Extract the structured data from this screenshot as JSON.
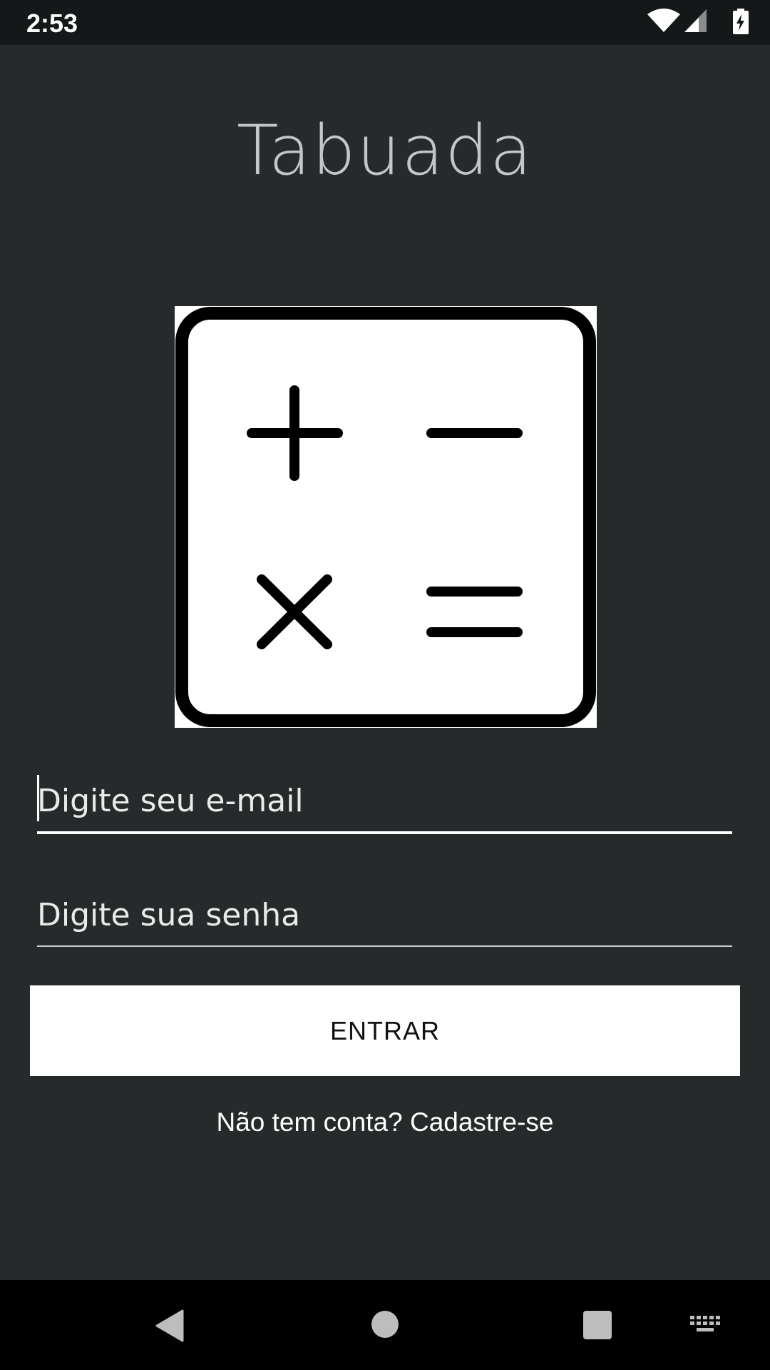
{
  "status_bar": {
    "time": "2:53",
    "icons": [
      "wifi-icon",
      "cell-signal-icon",
      "battery-charging-icon"
    ]
  },
  "app": {
    "title": "Tabuada",
    "logo_icon": "calculator-operations-icon"
  },
  "form": {
    "email_placeholder": "Digite seu e-mail",
    "email_value": "",
    "password_placeholder": "Digite sua senha",
    "password_value": "",
    "submit_label": "ENTRAR",
    "signup_text": "Não tem conta? Cadastre-se"
  },
  "nav_bar": {
    "icons": [
      "back-icon",
      "home-icon",
      "recents-icon",
      "keyboard-icon"
    ]
  },
  "colors": {
    "background": "#262a2b",
    "status_bar": "#151819",
    "nav_bar": "#000000",
    "button": "#ffffff",
    "title_text": "#c4c7c7"
  }
}
